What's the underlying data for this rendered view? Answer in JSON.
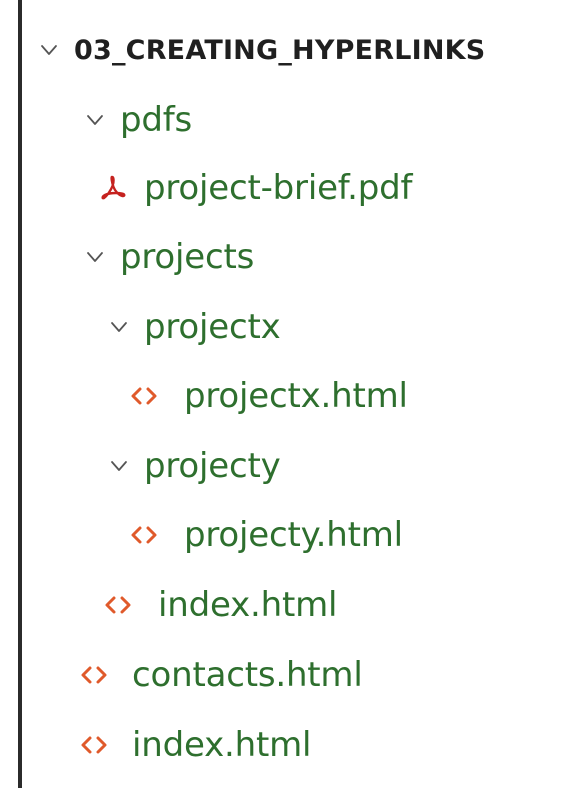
{
  "explorer": {
    "root": {
      "label": "03_CREATING_HYPERLINKS",
      "icon": "chevron-down-icon"
    },
    "items": [
      {
        "label": "pdfs",
        "kind": "folder",
        "icon": "chevron-down-icon"
      },
      {
        "label": "project-brief.pdf",
        "kind": "file",
        "icon": "pdf-icon"
      },
      {
        "label": "projects",
        "kind": "folder",
        "icon": "chevron-down-icon"
      },
      {
        "label": "projectx",
        "kind": "folder",
        "icon": "chevron-down-icon"
      },
      {
        "label": "projectx.html",
        "kind": "file",
        "icon": "html-icon"
      },
      {
        "label": "projecty",
        "kind": "folder",
        "icon": "chevron-down-icon"
      },
      {
        "label": "projecty.html",
        "kind": "file",
        "icon": "html-icon"
      },
      {
        "label": "index.html",
        "kind": "file",
        "icon": "html-icon"
      },
      {
        "label": "contacts.html",
        "kind": "file",
        "icon": "html-icon"
      },
      {
        "label": "index.html",
        "kind": "file",
        "icon": "html-icon"
      }
    ]
  },
  "colors": {
    "folder_text": "#2e6f2e",
    "root_text": "#1f1f1f",
    "html_icon": "#e05a2b",
    "pdf_icon": "#c5221f",
    "chevron": "#555555",
    "left_border": "#2b2b2b"
  }
}
